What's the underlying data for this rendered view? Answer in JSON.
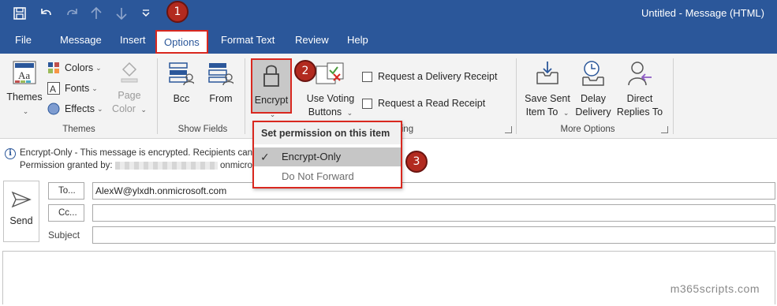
{
  "titlebar": {
    "title": "Untitled  -  Message (HTML)",
    "qat_icons": [
      "save-icon",
      "undo-icon",
      "redo-icon",
      "up-arrow-icon",
      "down-arrow-icon",
      "customize-chevron-icon"
    ]
  },
  "menu": {
    "tabs": [
      "File",
      "Message",
      "Insert",
      "Options",
      "Format Text",
      "Review",
      "Help"
    ],
    "active": "Options"
  },
  "ribbon": {
    "themes": {
      "themes_label": "Themes",
      "colors": "Colors",
      "fonts": "Fonts",
      "effects": "Effects",
      "page_color_1": "Page",
      "page_color_2": "Color",
      "group": "Themes"
    },
    "show_fields": {
      "bcc": "Bcc",
      "from": "From",
      "group": "Show Fields"
    },
    "permission": {
      "encrypt": "Encrypt"
    },
    "tracking": {
      "voting_1": "Use Voting",
      "voting_2": "Buttons",
      "delivery_receipt": "Request a Delivery Receipt",
      "read_receipt": "Request a Read Receipt",
      "group_partial": "king"
    },
    "more_options": {
      "save_sent_1": "Save Sent",
      "save_sent_2": "Item To",
      "delay_1": "Delay",
      "delay_2": "Delivery",
      "direct_1": "Direct",
      "direct_2": "Replies To",
      "group": "More Options"
    }
  },
  "dropdown": {
    "header": "Set permission on this item",
    "items": [
      "Encrypt-Only",
      "Do Not Forward"
    ],
    "selected": "Encrypt-Only"
  },
  "badges": [
    "1",
    "2",
    "3"
  ],
  "infobar": {
    "line1": "Encrypt-Only - This message is encrypted. Recipients can",
    "line2_prefix": "Permission granted by:",
    "line2_suffix": "onmicros"
  },
  "compose": {
    "send": "Send",
    "to_button": "To...",
    "cc_button": "Cc...",
    "subject_label": "Subject",
    "to_value": "AlexW@ylxdh.onmicrosoft.com",
    "cc_value": "",
    "subject_value": ""
  },
  "watermark": "m365scripts.com",
  "colors": {
    "accent": "#2b579a",
    "highlight": "#d9281f",
    "badge": "#b22a1f"
  }
}
